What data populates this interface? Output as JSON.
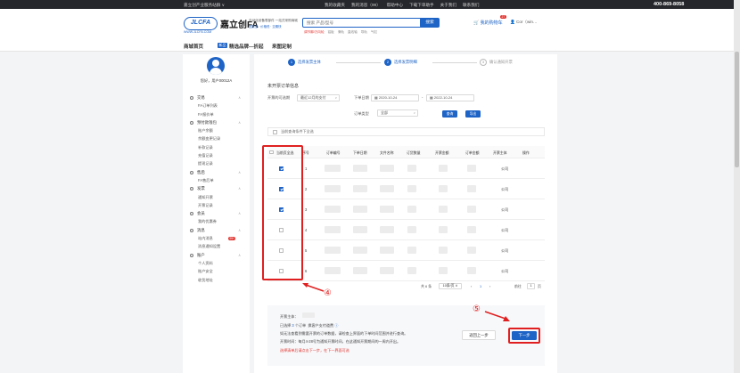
{
  "topbar": {
    "left": "嘉立创产业服务站群 ∨",
    "links": [
      "我的收藏夹",
      "我的消息（99）",
      "帮助中心",
      "下载下单助手",
      "关于我们",
      "联系我们"
    ],
    "phone": "400-869-8058"
  },
  "header": {
    "logo": "JLCFA",
    "logo_cn": "嘉立创FA",
    "url": "WWW.JLCFA.COM",
    "slogan1": "自动化设备零部件 一站式采购商城",
    "slogan2": "品类全 · 价格低 · 交期快",
    "search_placeholder": "搜索 产品/型号",
    "search_btn": "搜索",
    "hot": [
      "调节脚/万向轮",
      "铝板",
      "滑轨",
      "直线轴",
      "导轨",
      "气缸"
    ],
    "cart": "我的购物车",
    "cart_count": "27",
    "user": "Cor（win…"
  },
  "nav": {
    "home": "商城首页",
    "tag": "新品",
    "featured": "精选品牌—折起",
    "custom": "来图定制"
  },
  "sidebar": {
    "username": "您好，用户00012A",
    "groups": [
      {
        "name": "交易",
        "items": [
          "FA订单列表",
          "FA报价单"
        ]
      },
      {
        "name": "预付款钱包",
        "items": [
          "账户余额",
          "余额变更记录",
          "补款记录",
          "充值记录",
          "提现记录"
        ]
      },
      {
        "name": "售后",
        "items": [
          "FA售后单"
        ]
      },
      {
        "name": "发票",
        "items": [
          "通知开票",
          "开票记录"
        ]
      },
      {
        "name": "会员",
        "items": [
          "我的优惠券"
        ]
      },
      {
        "name": "消息",
        "items": [
          "站内消息",
          "消息通知设置"
        ]
      },
      {
        "name": "账户",
        "items": [
          "个人资料",
          "账户安全",
          "收货地址"
        ]
      }
    ],
    "msg_badge": "99+"
  },
  "steps": [
    {
      "num": "1",
      "label": "选择发票主体"
    },
    {
      "num": "2",
      "label": "选择发票明细"
    },
    {
      "num": "3",
      "label": "确认通知开票"
    }
  ],
  "filters": {
    "title": "未开票订单信息",
    "period_label": "开票的可选期",
    "period_value": "最近12月的支付",
    "date_label": "下单日期",
    "date_from": "2020-10-24",
    "date_to": "2022-10-24",
    "type_label": "订单类型",
    "type_value": "全部",
    "query": "查询",
    "export": "导出",
    "check_all_label": "当前查询条件下全选"
  },
  "table": {
    "headers": [
      "当前页全选",
      "序号",
      "订单编号",
      "下单日期",
      "文件名称",
      "订货数量",
      "开票金额",
      "订单金额",
      "开票主体",
      "操作"
    ],
    "rows": [
      {
        "idx": "1",
        "checked": true,
        "subject": "公司"
      },
      {
        "idx": "2",
        "checked": true,
        "subject": "公司"
      },
      {
        "idx": "3",
        "checked": true,
        "subject": "公司"
      },
      {
        "idx": "4",
        "checked": false,
        "subject": "公司"
      },
      {
        "idx": "5",
        "checked": false,
        "subject": "公司"
      },
      {
        "idx": "6",
        "checked": false,
        "subject": "公司"
      }
    ]
  },
  "pager": {
    "total": "共 6 条",
    "size": "10条/页",
    "page": "1",
    "goto_label": "前往",
    "goto_value": "1",
    "goto_unit": "页"
  },
  "footer": {
    "invoice_label": "开票主体：",
    "line1_a": "已选择",
    "line1_count": "3",
    "line1_b": "个订单",
    "line1_c": "换客户支付道费",
    "line2": "如无法查看到需要开票的订单数据，请检查上界面的下单时间范围并进行查询。",
    "line3": "开票时间：每月4-28号为通知开票时间，在这通知开票期间的一周内开出。",
    "line4": "选择清单后请点击下一步，在下一界面可选",
    "prev": "返回上一步",
    "next": "下一步"
  },
  "annotations": {
    "a4": "④",
    "a5": "⑤"
  },
  "colors": {
    "accent": "#1e63c6",
    "annotation": "#e02020"
  }
}
